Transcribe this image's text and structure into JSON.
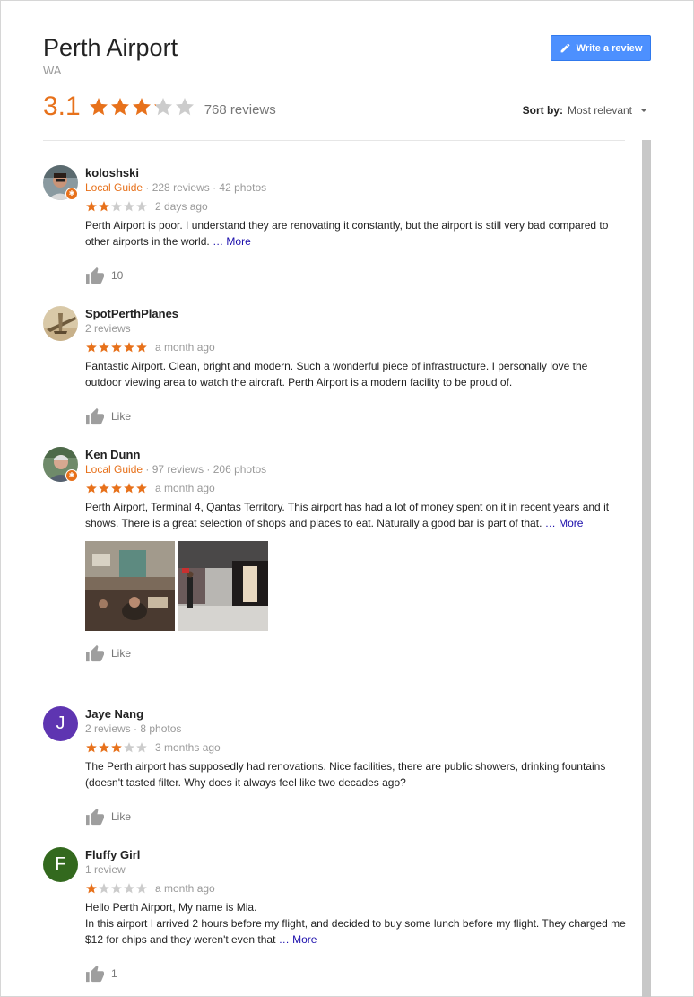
{
  "place": {
    "title": "Perth Airport",
    "subtitle": "WA",
    "rating": "3.1",
    "rating_value": 3.1,
    "review_count": "768 reviews"
  },
  "header": {
    "write_review_label": "Write a review",
    "sort_label": "Sort by:",
    "sort_value": "Most relevant"
  },
  "colors": {
    "star_filled": "#e7711b",
    "star_empty": "#cccccc",
    "accent_blue": "#4d90fe",
    "link": "#1a0dab"
  },
  "reviews": [
    {
      "name": "koloshski",
      "guide": "Local Guide",
      "meta": " · 228 reviews · 42 photos",
      "stars": 2,
      "date": "2 days ago",
      "text": "Perth Airport is poor. I understand they are renovating it constantly, but the airport is still very bad compared to other airports in the world. ",
      "more": "… More",
      "likes": "10",
      "avatar_icon": "user-photo-icon"
    },
    {
      "name": "SpotPerthPlanes",
      "guide": "",
      "meta": "2 reviews",
      "stars": 5,
      "date": "a month ago",
      "text": "Fantastic Airport. Clean, bright and modern.  Such a wonderful piece of infrastructure.  I personally love the outdoor viewing area to watch the aircraft.  Perth Airport is a modern facility to be proud of.",
      "more": "",
      "likes": "Like",
      "avatar_icon": "airplane-photo-icon"
    },
    {
      "name": "Ken Dunn",
      "guide": "Local Guide",
      "meta": " · 97 reviews · 206 photos",
      "stars": 5,
      "date": "a month ago",
      "text": "Perth Airport, Terminal 4, Qantas Territory. This airport has had a lot of money spent on it in recent years and it shows. There is a great selection of shops and places to eat. Naturally a good bar is part of that. ",
      "more": "… More",
      "likes": "Like",
      "avatar_icon": "user-photo-icon"
    },
    {
      "name": "Jaye Nang",
      "guide": "",
      "meta": "2 reviews · 8 photos",
      "stars": 3,
      "date": "3 months ago",
      "text": "The Perth airport has supposedly had renovations. Nice facilities, there are public showers, drinking fountains (doesn't tasted filter.  Why does it always feel like two decades ago?",
      "more": "",
      "likes": "Like",
      "avatar_letter": "J",
      "avatar_color": "#5e35b1"
    },
    {
      "name": "Fluffy Girl",
      "guide": "",
      "meta": "1 review",
      "stars": 1,
      "date": "a month ago",
      "text_line1": "Hello Perth Airport, My name is Mia.",
      "text": "In this airport I arrived 2 hours before my flight, and decided to buy some lunch before my flight. They charged me $12 for chips and they weren't even that ",
      "more": "… More",
      "likes": "1",
      "avatar_letter": "F",
      "avatar_color": "#33691e"
    }
  ]
}
